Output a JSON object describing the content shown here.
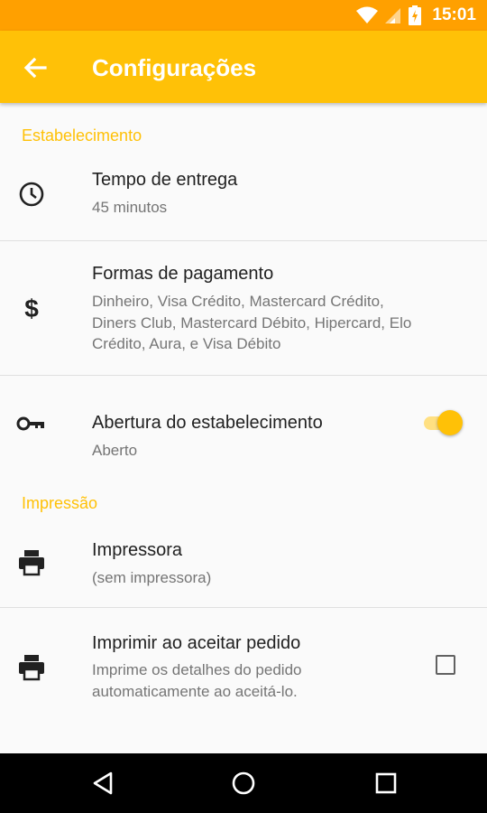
{
  "status_bar": {
    "time": "15:01",
    "icons": [
      "wifi-icon",
      "signal-icon",
      "battery-icon"
    ]
  },
  "app_bar": {
    "title": "Configurações",
    "back_icon": "arrow-back-icon"
  },
  "sections": {
    "establishment": {
      "header": "Estabelecimento"
    },
    "printing": {
      "header": "Impressão"
    }
  },
  "items": {
    "delivery_time": {
      "title": "Tempo de entrega",
      "subtitle": "45 minutos",
      "icon": "clock-icon"
    },
    "payment_methods": {
      "title": "Formas de pagamento",
      "subtitle_lines": [
        "Dinheiro, Visa Crédito, Mastercard Crédito,",
        "Diners Club, Mastercard Débito, Hipercard, Elo",
        "Crédito, Aura,  e Visa Débito"
      ],
      "icon": "dollar-icon"
    },
    "opening": {
      "title": "Abertura do estabelecimento",
      "subtitle": "Aberto",
      "icon": "key-icon",
      "toggle_on": true
    },
    "printer": {
      "title": "Impressora",
      "subtitle": "(sem impressora)",
      "icon": "printer-icon"
    },
    "print_on_accept": {
      "title": "Imprimir ao aceitar pedido",
      "subtitle_lines": [
        "Imprime os detalhes do pedido",
        "automaticamente ao aceitá-lo."
      ],
      "icon": "printer-icon",
      "checked": false
    }
  },
  "nav_bar": {
    "buttons": [
      "back-triangle-icon",
      "home-circle-icon",
      "recents-square-icon"
    ]
  },
  "colors": {
    "accent": "#FFC107",
    "status_bar": "#FFA000",
    "text_primary": "#212121",
    "text_secondary": "#757575"
  }
}
